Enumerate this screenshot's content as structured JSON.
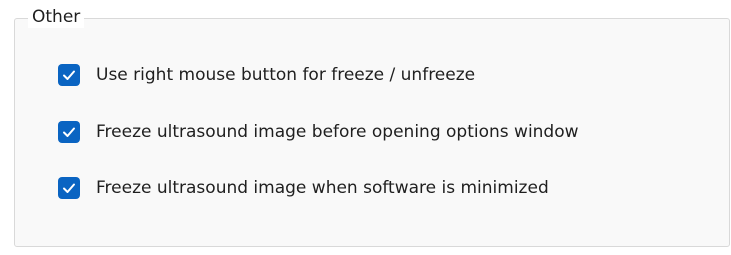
{
  "group": {
    "title": "Other",
    "options": [
      {
        "label": "Use right mouse button for freeze / unfreeze",
        "checked": true
      },
      {
        "label": "Freeze ultrasound image before opening options window",
        "checked": true
      },
      {
        "label": "Freeze ultrasound image when software is minimized",
        "checked": true
      }
    ]
  },
  "colors": {
    "checkbox_fill": "#0a64c2",
    "checkmark": "#ffffff",
    "group_border": "#d9d9d9",
    "group_background": "#f9f9f9",
    "text": "#1f1f1f"
  },
  "icons": {
    "checkmark": "check-icon"
  }
}
